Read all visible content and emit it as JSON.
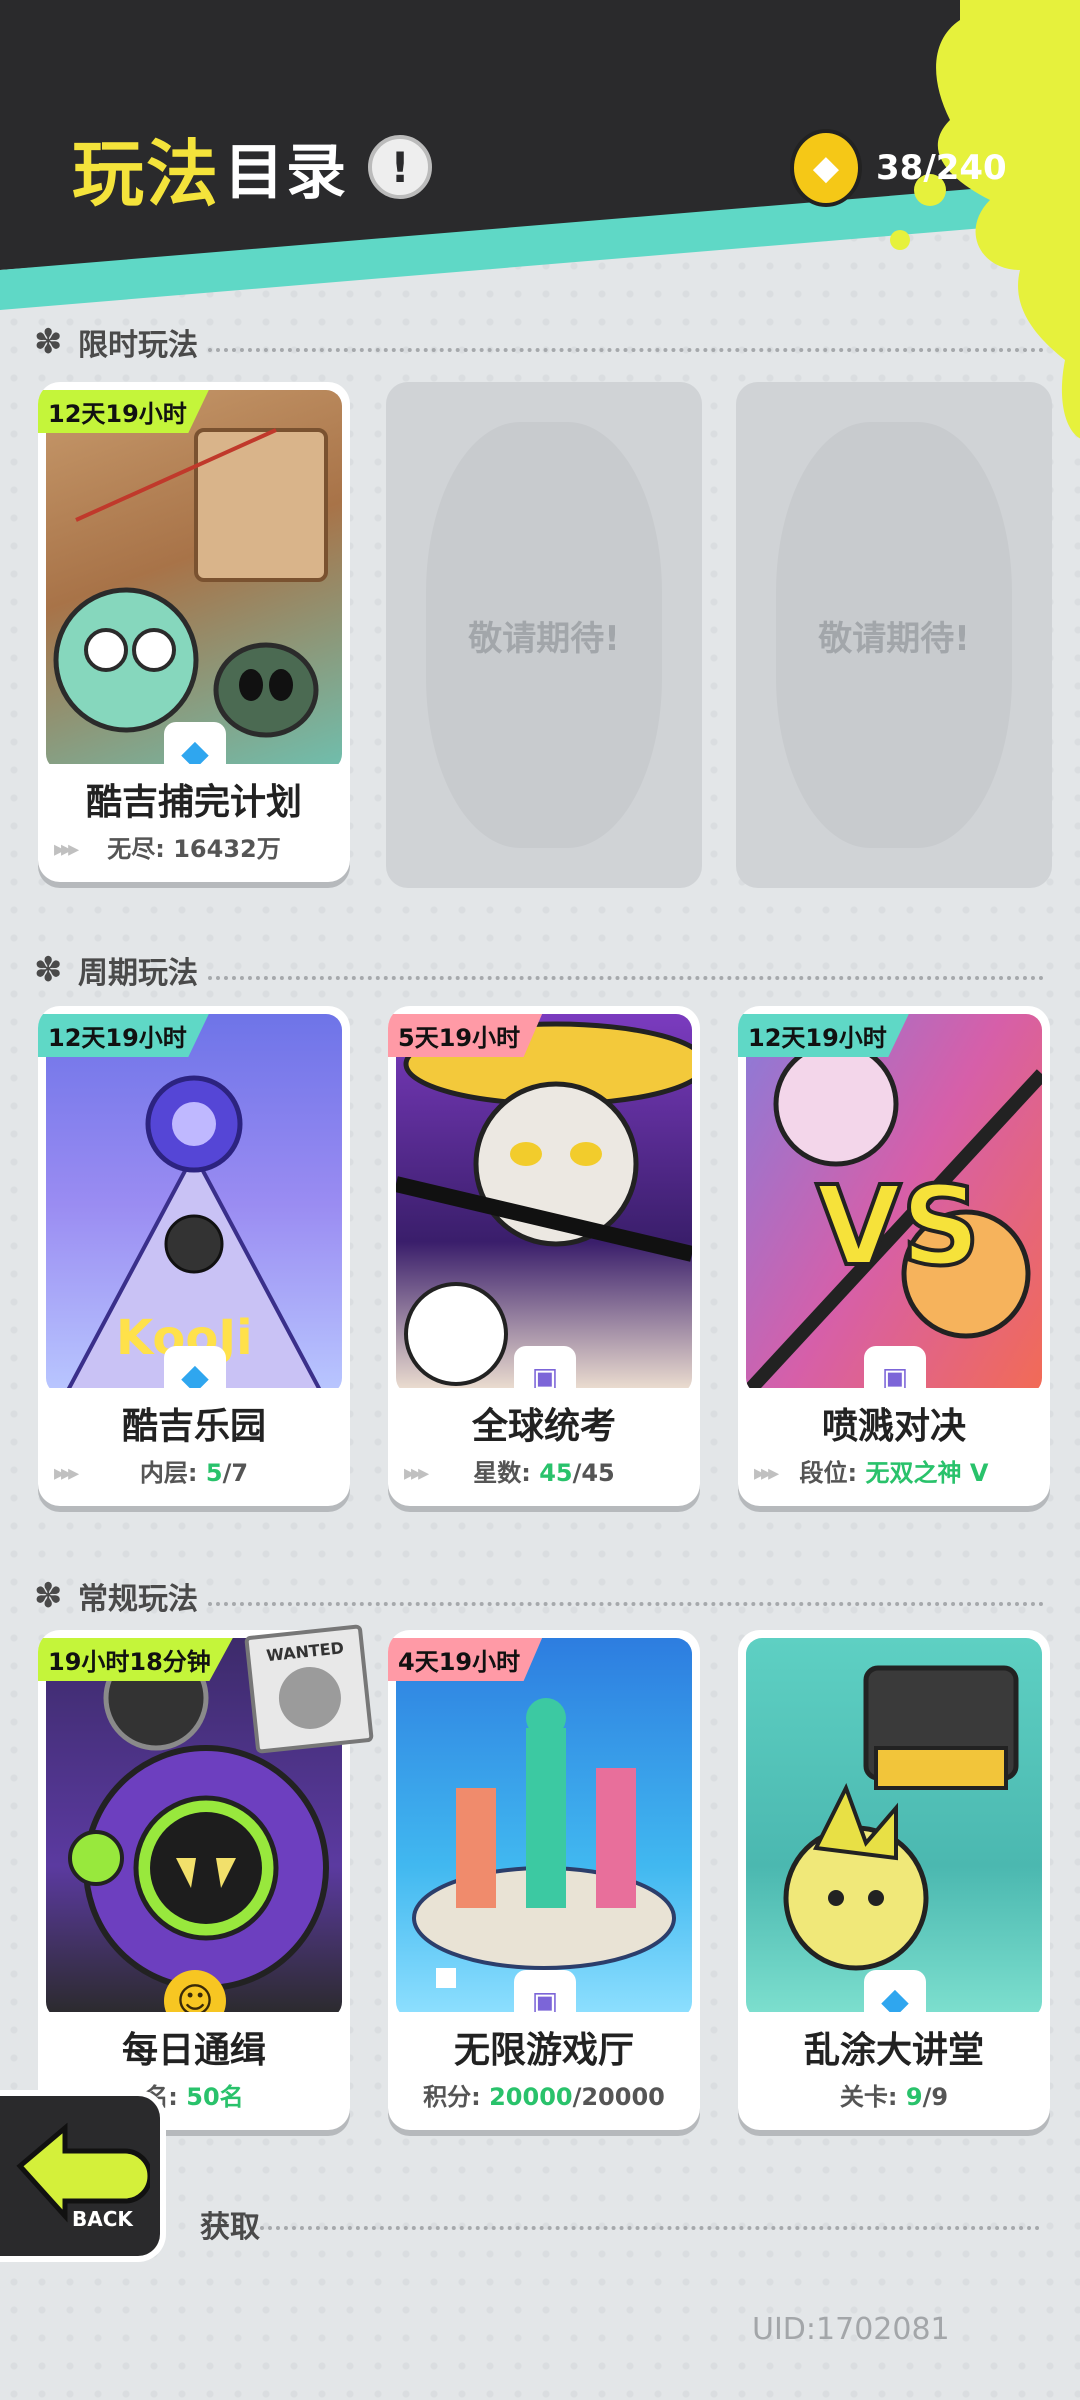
{
  "header": {
    "title_part1": "玩法",
    "title_part2": "目录",
    "info_icon": "!",
    "currency_icon": "coin-icon",
    "currency_value": "38/240",
    "add_label": "+"
  },
  "sections": {
    "limited": "限时玩法",
    "periodic": "周期玩法",
    "regular": "常规玩法",
    "bottom": "获取"
  },
  "limited_cards": [
    {
      "tag": "12天19小时",
      "name": "酷吉捕完计划",
      "sub_label": "无尽:",
      "sub_value": "16432万",
      "sub_total": ""
    }
  ],
  "coming_soon": [
    "敬请期待!",
    "敬请期待!"
  ],
  "periodic_cards": [
    {
      "tag": "12天19小时",
      "name": "酷吉乐园",
      "sub_label": "内层:",
      "sub_value": "5",
      "sub_total": "/7"
    },
    {
      "tag": "5天19小时",
      "name": "全球统考",
      "sub_label": "星数:",
      "sub_value": "45",
      "sub_total": "/45"
    },
    {
      "tag": "12天19小时",
      "name": "喷溅对决",
      "sub_label": "段位:",
      "sub_value": "无双之神 V",
      "sub_total": ""
    }
  ],
  "regular_cards": [
    {
      "tag": "19小时18分钟",
      "name": "每日通缉",
      "sub_label": "名:",
      "sub_value": "50名",
      "sub_total": ""
    },
    {
      "tag": "4天19小时",
      "name": "无限游戏厅",
      "sub_label": "积分:",
      "sub_value": "20000",
      "sub_total": "/20000"
    },
    {
      "tag": "",
      "name": "乱涂大讲堂",
      "sub_label": "关卡:",
      "sub_value": "9",
      "sub_total": "/9"
    }
  ],
  "wanted_label": "WANTED",
  "back_label": "BACK",
  "uid": "UID:1702081",
  "colors": {
    "accent_yellow": "#f4e33b",
    "teal": "#5fd8c6",
    "lime": "#c4f53a",
    "highlight_green": "#29c26b"
  }
}
